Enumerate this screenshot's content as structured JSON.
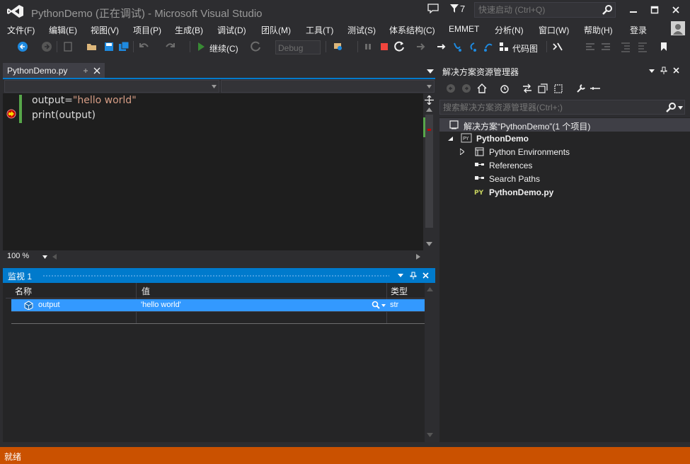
{
  "window": {
    "title": "PythonDemo (正在调试) - Microsoft Visual Studio",
    "notification_count": "7",
    "quick_launch_placeholder": "快速启动 (Ctrl+Q)"
  },
  "menu": {
    "items": [
      "文件(F)",
      "编辑(E)",
      "视图(V)",
      "项目(P)",
      "生成(B)",
      "调试(D)",
      "团队(M)",
      "工具(T)",
      "测试(S)",
      "体系结构(C)",
      "EMMET",
      "分析(N)",
      "窗口(W)",
      "帮助(H)"
    ],
    "login": "登录"
  },
  "toolbar": {
    "continue_label": "继续(C)",
    "config_value": "Debug",
    "codemap_label": "代码图"
  },
  "editor": {
    "tab_label": "PythonDemo.py",
    "zoom": "100 %",
    "lines": [
      {
        "code": "output=",
        "string": "\"hello world\""
      },
      {
        "code": "print(output)",
        "string": ""
      }
    ]
  },
  "watch": {
    "title": "监视 1",
    "columns": [
      "名称",
      "值",
      "类型"
    ],
    "rows": [
      {
        "name": "output",
        "value": "'hello world'",
        "type": "str"
      }
    ]
  },
  "solution_explorer": {
    "title": "解决方案资源管理器",
    "search_placeholder": "搜索解决方案资源管理器(Ctrl+;)",
    "solution_label": "解决方案“PythonDemo”(1 个项目)",
    "project": "PythonDemo",
    "children": [
      "Python Environments",
      "References",
      "Search Paths",
      "PythonDemo.py"
    ]
  },
  "status": {
    "text": "就绪"
  },
  "colors": {
    "accent": "#007acc",
    "status_bar": "#ca5100",
    "selection": "#3399ff",
    "string_literal": "#d69d85"
  }
}
